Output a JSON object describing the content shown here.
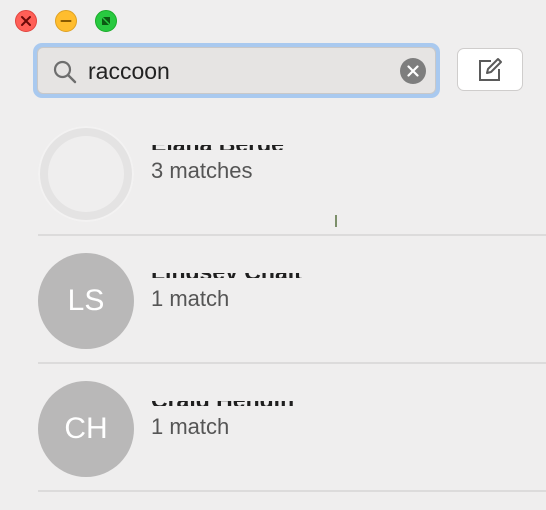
{
  "window": {
    "controls": {
      "close_icon": "close-icon",
      "minimize_icon": "minimize-icon",
      "zoom_icon": "fullscreen-icon"
    }
  },
  "search": {
    "value": "raccoon",
    "icon": "search-icon",
    "clear_icon": "clear-icon"
  },
  "compose": {
    "icon": "compose-icon"
  },
  "conversations": [
    {
      "name": "Eiana Berge",
      "initials": "",
      "match_text": "3 matches"
    },
    {
      "name": "Lindsey Chait",
      "initials": "LS",
      "match_text": "1 match"
    },
    {
      "name": "Craig Hendin",
      "initials": "CH",
      "match_text": "1 match"
    }
  ],
  "colors": {
    "close": "#ff5f57",
    "minimize": "#ffbd2e",
    "zoom": "#28c940",
    "search_focus_ring": "#a9c9ef",
    "avatar": "#b9b8b8"
  }
}
